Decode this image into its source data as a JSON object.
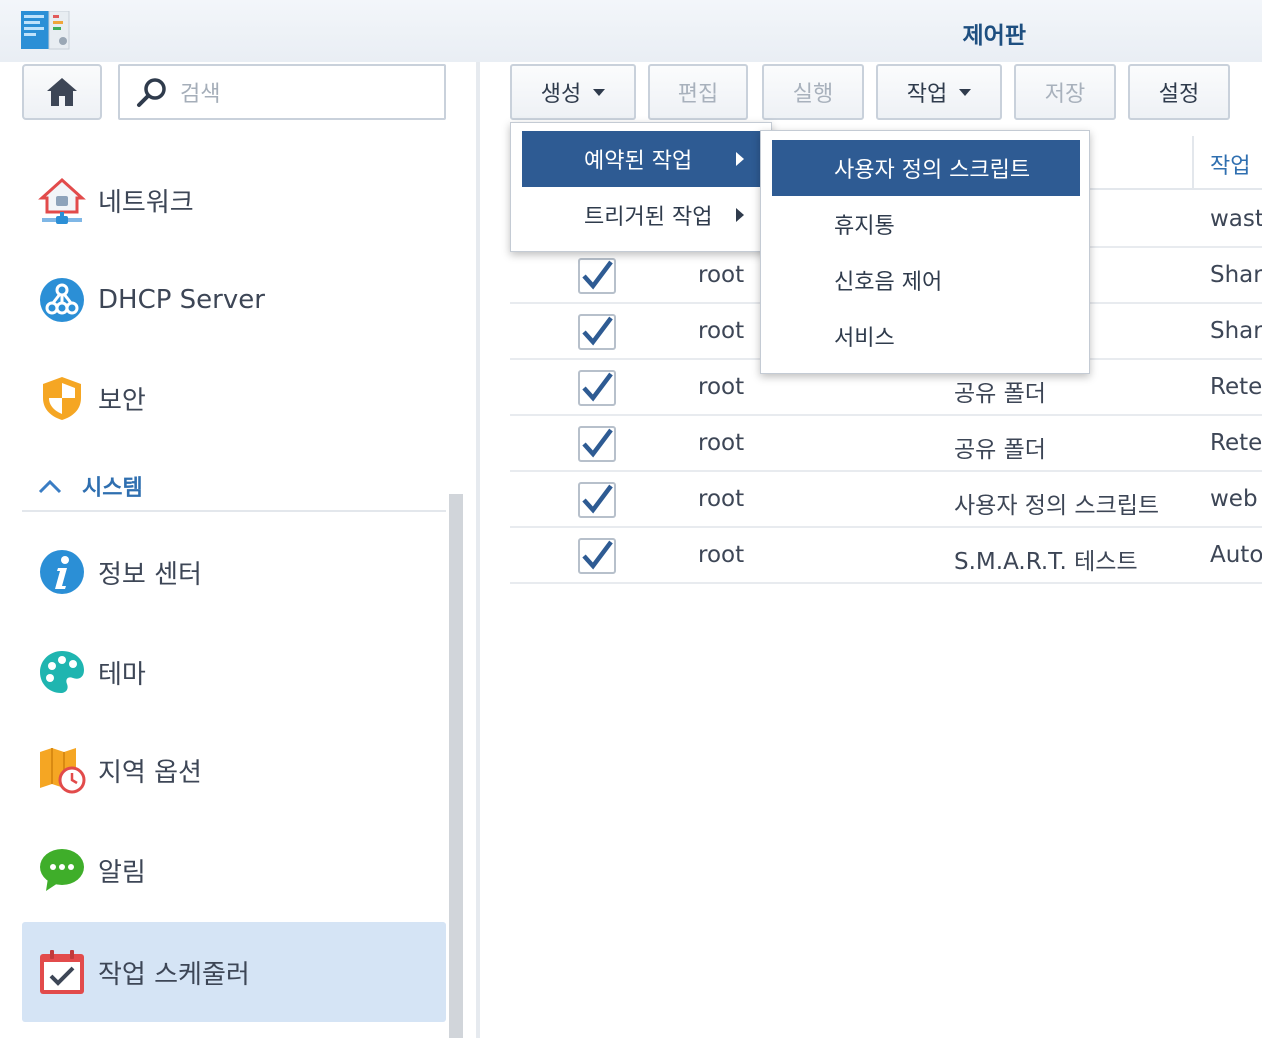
{
  "window": {
    "title": "제어판"
  },
  "sidebar": {
    "search_placeholder": "검색",
    "items_top": [
      {
        "label": "네트워크",
        "icon": "network-icon"
      },
      {
        "label": "DHCP Server",
        "icon": "dhcp-server-icon"
      },
      {
        "label": "보안",
        "icon": "security-shield-icon"
      }
    ],
    "section": {
      "label": "시스템",
      "icon": "chevron-up-icon"
    },
    "items_system": [
      {
        "label": "정보 센터",
        "icon": "info-icon"
      },
      {
        "label": "테마",
        "icon": "palette-icon"
      },
      {
        "label": "지역 옵션",
        "icon": "regional-map-clock-icon"
      },
      {
        "label": "알림",
        "icon": "chat-bubble-icon"
      },
      {
        "label": "작업 스케줄러",
        "icon": "calendar-check-icon",
        "active": true
      }
    ]
  },
  "toolbar": {
    "create": "생성",
    "edit": "편집",
    "run": "실행",
    "action": "작업",
    "save": "저장",
    "settings": "설정"
  },
  "table": {
    "col_action": "작업",
    "rows": [
      {
        "checked": true,
        "owner": "",
        "type": "",
        "action": "wast"
      },
      {
        "checked": true,
        "owner": "root",
        "type": "",
        "action": "Shar"
      },
      {
        "checked": true,
        "owner": "root",
        "type": "",
        "action": "Shar"
      },
      {
        "checked": true,
        "owner": "root",
        "type": "공유 폴더",
        "action": "Rete"
      },
      {
        "checked": true,
        "owner": "root",
        "type": "공유 폴더",
        "action": "Rete"
      },
      {
        "checked": true,
        "owner": "root",
        "type": "사용자 정의 스크립트",
        "action": "web"
      },
      {
        "checked": true,
        "owner": "root",
        "type": "S.M.A.R.T. 테스트",
        "action": "Auto"
      }
    ]
  },
  "create_menu": {
    "items": [
      {
        "label": "예약된 작업",
        "selected": true
      },
      {
        "label": "트리거된 작업",
        "selected": false
      }
    ]
  },
  "submenu": {
    "items": [
      {
        "label": "사용자 정의 스크립트",
        "selected": true
      },
      {
        "label": "휴지통",
        "selected": false
      },
      {
        "label": "신호음 제어",
        "selected": false
      },
      {
        "label": "서비스",
        "selected": false
      }
    ]
  },
  "colors": {
    "accent": "#2e5b93",
    "active_bg": "#d5e4f5",
    "link": "#2f6fb0"
  }
}
